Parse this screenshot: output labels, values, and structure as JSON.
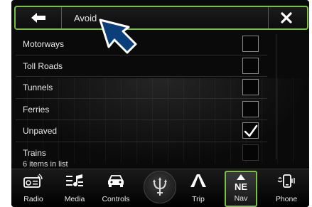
{
  "header": {
    "title": "Avoid"
  },
  "avoid_list": {
    "items": [
      {
        "label": "Motorways",
        "checked": false
      },
      {
        "label": "Toll Roads",
        "checked": false
      },
      {
        "label": "Tunnels",
        "checked": false
      },
      {
        "label": "Ferries",
        "checked": false
      },
      {
        "label": "Unpaved",
        "checked": true
      },
      {
        "label": "Trains",
        "checked": false
      }
    ],
    "count_text": "6 items in list"
  },
  "navbar": {
    "items": [
      {
        "label": "Radio",
        "icon": "radio-icon"
      },
      {
        "label": "Media",
        "icon": "media-icon"
      },
      {
        "label": "Controls",
        "icon": "controls-icon"
      },
      {
        "label": "Trip",
        "icon": "trip-icon"
      },
      {
        "label": "Nav",
        "icon": "compass-icon",
        "heading": "NE",
        "active": true
      },
      {
        "label": "Phone",
        "icon": "phone-icon"
      }
    ]
  },
  "colors": {
    "accent": "#7ac143",
    "background": "#0a0a0a",
    "text": "#eaeaea"
  }
}
